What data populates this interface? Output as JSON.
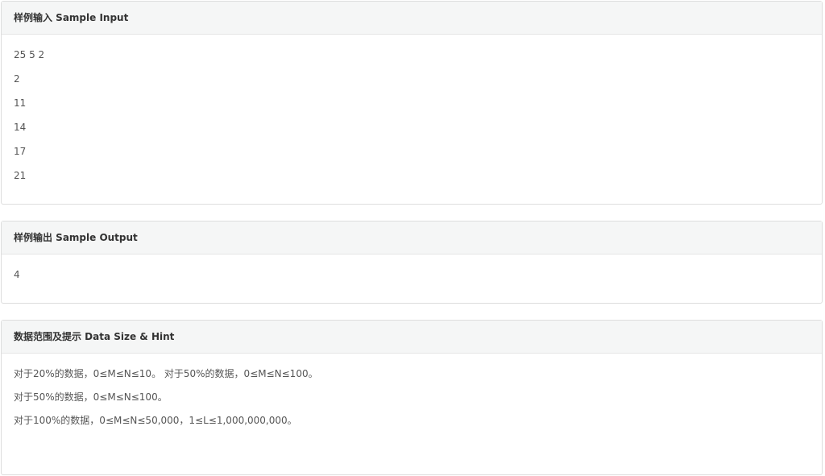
{
  "sample_input": {
    "title": "样例输入 Sample Input",
    "lines": [
      "25 5 2",
      "2",
      "11",
      "14",
      "17",
      "21"
    ]
  },
  "sample_output": {
    "title": "样例输出 Sample Output",
    "lines": [
      "4"
    ]
  },
  "hint": {
    "title": "数据范围及提示 Data Size & Hint",
    "lines": [
      "对于20%的数据，0≤M≤N≤10。 对于50%的数据，0≤M≤N≤100。",
      "对于50%的数据，0≤M≤N≤100。",
      "对于100%的数据，0≤M≤N≤50,000，1≤L≤1,000,000,000。"
    ]
  }
}
